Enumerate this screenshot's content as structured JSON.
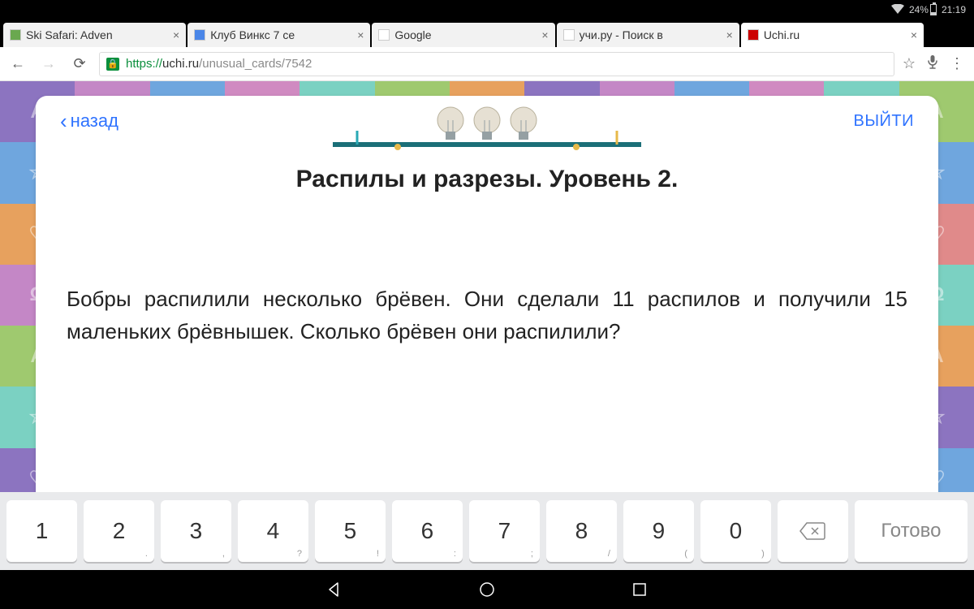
{
  "status": {
    "battery_pct": "24%",
    "time": "21:19"
  },
  "tabs": [
    {
      "label": "Ski Safari: Adven",
      "active": false
    },
    {
      "label": "Клуб Винкс 7 се",
      "active": false
    },
    {
      "label": "Google",
      "active": false
    },
    {
      "label": "учи.ру - Поиск в",
      "active": false
    },
    {
      "label": "Uchi.ru",
      "active": true
    }
  ],
  "url": {
    "scheme": "https",
    "host": "uchi.ru",
    "path": "/unusual_cards/7542"
  },
  "card": {
    "back": "назад",
    "exit": "ВЫЙТИ",
    "title": "Распилы и разрезы. Уровень 2.",
    "body": "Бобры распилили несколько брёвен. Они сделали 11 распилов и получили 15 маленьких брёвнышек. Сколько брёвен они распилили?"
  },
  "keyboard": {
    "keys": [
      "1",
      "2",
      "3",
      "4",
      "5",
      "6",
      "7",
      "8",
      "9",
      "0"
    ],
    "subs": [
      "",
      ".",
      ",",
      "?",
      "!",
      ":",
      ";",
      "/",
      "(",
      ")"
    ],
    "done": "Готово"
  },
  "bg_colors": [
    [
      "#8c74c0",
      "#c487c6",
      "#6fa6de",
      "#d08ac1",
      "#7bd1c2",
      "#9fc96f",
      "#e7a15e",
      "#8c74c0",
      "#c487c6",
      "#6fa6de",
      "#d08ac1",
      "#7bd1c2",
      "#9fc96f"
    ],
    [
      "#6fa6de",
      "#7bd1c2",
      "#e08a8a",
      "#9fc96f",
      "#8c74c0",
      "#c487c6",
      "#6fa6de",
      "#7bd1c2",
      "#e08a8a",
      "#9fc96f",
      "#8c74c0",
      "#c487c6",
      "#6fa6de"
    ],
    [
      "#e7a15e",
      "#8c74c0",
      "#7bd1c2",
      "#c487c6",
      "#6fa6de",
      "#e08a8a",
      "#9fc96f",
      "#e7a15e",
      "#8c74c0",
      "#7bd1c2",
      "#c487c6",
      "#6fa6de",
      "#e08a8a"
    ],
    [
      "#c487c6",
      "#6fa6de",
      "#9fc96f",
      "#e7a15e",
      "#e08a8a",
      "#7bd1c2",
      "#8c74c0",
      "#c487c6",
      "#6fa6de",
      "#9fc96f",
      "#e7a15e",
      "#e08a8a",
      "#7bd1c2"
    ],
    [
      "#9fc96f",
      "#e08a8a",
      "#8c74c0",
      "#6fa6de",
      "#c487c6",
      "#e7a15e",
      "#7bd1c2",
      "#9fc96f",
      "#e08a8a",
      "#8c74c0",
      "#6fa6de",
      "#c487c6",
      "#e7a15e"
    ],
    [
      "#7bd1c2",
      "#e7a15e",
      "#c487c6",
      "#e08a8a",
      "#9fc96f",
      "#8c74c0",
      "#6fa6de",
      "#7bd1c2",
      "#e7a15e",
      "#c487c6",
      "#e08a8a",
      "#9fc96f",
      "#8c74c0"
    ],
    [
      "#8c74c0",
      "#9fc96f",
      "#e08a8a",
      "#7bd1c2",
      "#e7a15e",
      "#6fa6de",
      "#c487c6",
      "#8c74c0",
      "#9fc96f",
      "#e08a8a",
      "#7bd1c2",
      "#e7a15e",
      "#6fa6de"
    ],
    [
      "#6fa6de",
      "#c487c6",
      "#e7a15e",
      "#8c74c0",
      "#7bd1c2",
      "#9fc96f",
      "#e08a8a",
      "#6fa6de",
      "#c487c6",
      "#e7a15e",
      "#8c74c0",
      "#7bd1c2",
      "#9fc96f"
    ]
  ],
  "bg_glyphs": [
    "А",
    "☆",
    "♡",
    "Ω",
    "А",
    "☆",
    "♡",
    "Ω"
  ]
}
